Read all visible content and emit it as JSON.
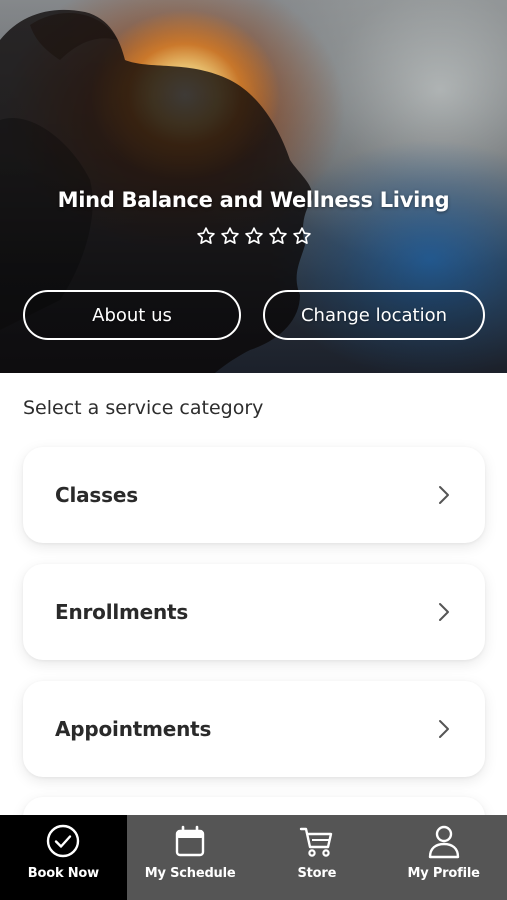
{
  "hero": {
    "title": "Mind Balance and Wellness Living",
    "rating": {
      "filled": 0,
      "max": 5
    },
    "about_label": "About us",
    "change_location_label": "Change location"
  },
  "services": {
    "heading": "Select a service category",
    "items": [
      {
        "label": "Classes"
      },
      {
        "label": "Enrollments"
      },
      {
        "label": "Appointments"
      }
    ]
  },
  "tabbar": {
    "tabs": [
      {
        "label": "Book Now",
        "icon": "check-circle-icon",
        "active": true
      },
      {
        "label": "My Schedule",
        "icon": "calendar-icon",
        "active": false
      },
      {
        "label": "Store",
        "icon": "cart-icon",
        "active": false
      },
      {
        "label": "My Profile",
        "icon": "user-icon",
        "active": false
      }
    ]
  },
  "colors": {
    "tab_active_bg": "#000000",
    "tab_bar_bg": "#555555",
    "text_primary": "#2a2a2a"
  }
}
